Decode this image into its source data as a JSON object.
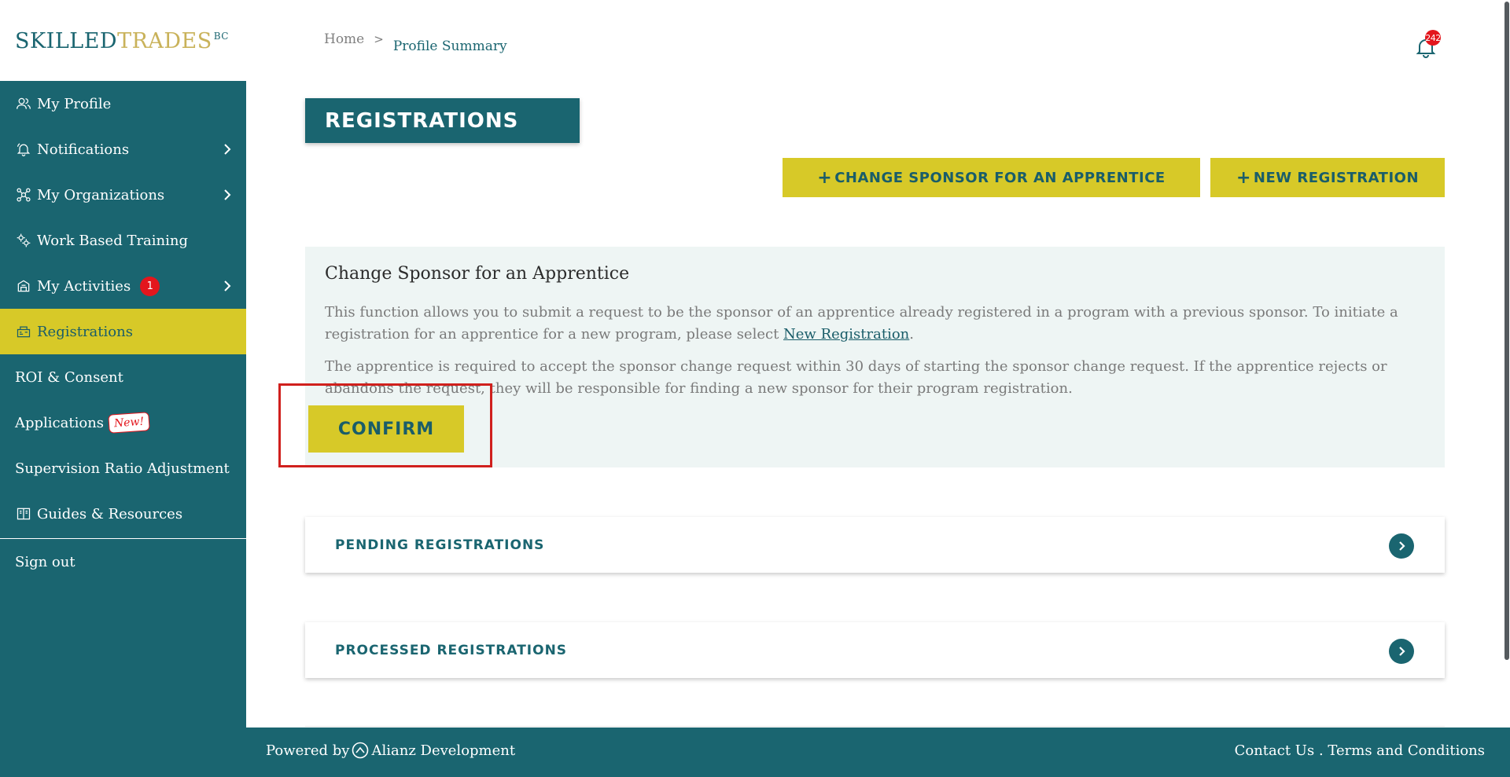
{
  "logo": {
    "part1": "SKILLED",
    "part2": "TRADES",
    "suffix": "BC"
  },
  "nav": {
    "items": [
      {
        "label": "My Profile"
      },
      {
        "label": "Notifications"
      },
      {
        "label": "My Organizations"
      },
      {
        "label": "Work Based Training"
      },
      {
        "label": "My Activities",
        "badge": "1"
      },
      {
        "label": "Registrations"
      },
      {
        "label": "ROI & Consent"
      },
      {
        "label": "Applications",
        "badge": "New!"
      },
      {
        "label": "Supervision Ratio Adjustment"
      },
      {
        "label": "Guides & Resources"
      }
    ],
    "sign_out": "Sign out"
  },
  "breadcrumb": {
    "home": "Home",
    "separator": ">",
    "current": "Profile Summary"
  },
  "header": {
    "notification_count": "242"
  },
  "page": {
    "title": "REGISTRATIONS",
    "change_sponsor_label": "CHANGE SPONSOR FOR AN APPRENTICE",
    "new_registration_label": "NEW REGISTRATION",
    "plus": "+"
  },
  "panel": {
    "title": "Change Sponsor for an Apprentice",
    "p1_before": "This function allows you to submit a request to be the sponsor of an apprentice already registered in a program with a previous sponsor. To initiate a registration for an apprentice for a new program, please select ",
    "p1_link": "New Registration",
    "p1_after": ".",
    "p2": "The apprentice is required to accept the sponsor change request within 30 days of starting the sponsor change request. If the apprentice rejects or abandons the request, they will be responsible for finding a new sponsor for their program registration.",
    "confirm_label": "CONFIRM"
  },
  "sections": {
    "pending": "PENDING REGISTRATIONS",
    "processed": "PROCESSED REGISTRATIONS"
  },
  "footer": {
    "powered_by": "Powered by",
    "company": "Alianz Development",
    "contact": "Contact Us",
    "separator": " . ",
    "terms": "Terms and Conditions"
  },
  "icons": {
    "profile": "user-icon",
    "notifications": "bell-icon",
    "organizations": "network-icon",
    "training": "gears-icon",
    "activities": "clipboard-icon",
    "registrations": "register-icon",
    "guides": "book-icon"
  },
  "colors": {
    "teal": "#1a6570",
    "yellow": "#d7c928",
    "panel_bg": "#eef5f4",
    "red": "#e3161d"
  }
}
